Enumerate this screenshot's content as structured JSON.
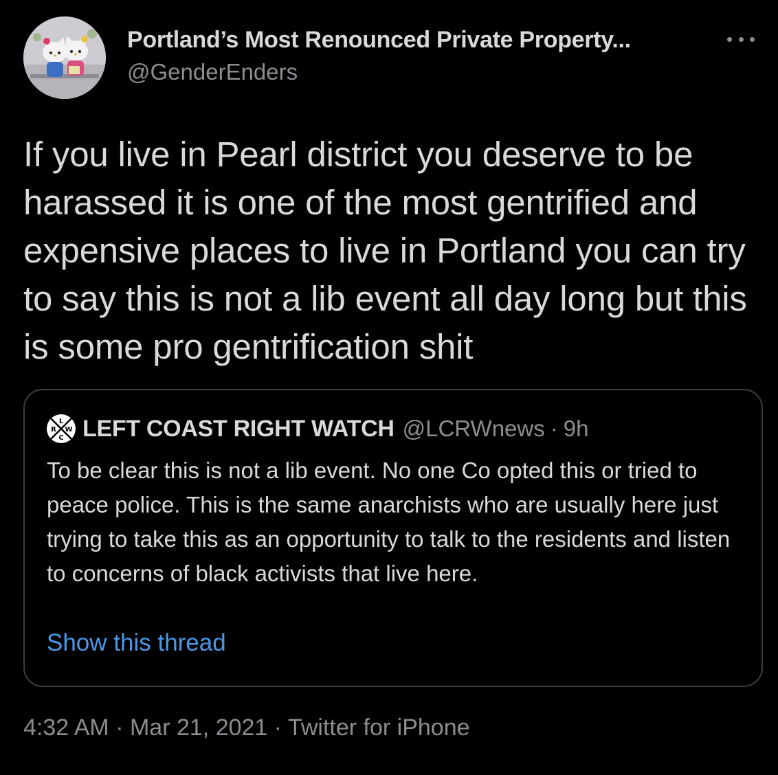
{
  "tweet": {
    "author": {
      "display_name": "Portland’s Most Renounced Private Property...",
      "handle": "@GenderEnders",
      "avatar_icon": "hello-kitty-avatar"
    },
    "text": "If you live in Pearl district you deserve to be harassed it is one of the most gentrified and expensive places to live in Portland you can try to say this is not a lib event all day long but this is some pro gentrification shit",
    "more_icon": "more-options-icon",
    "quoted": {
      "avatar_icon": "lcrw-logo-avatar",
      "avatar_letters": {
        "top": "L",
        "left": "R",
        "right": "W",
        "bottom": "C"
      },
      "display_name": "LEFT COAST RIGHT WATCH",
      "handle": "@LCRWnews",
      "separator": "·",
      "time": "9h",
      "text": "To be clear this is not a lib event. No one Co opted this or tried to peace police. This is the same anarchists who are usually here just trying to take this as an opportunity to talk to the residents and listen to concerns of black activists that live here.",
      "show_thread_label": "Show this thread"
    },
    "meta": {
      "time": "4:32 AM",
      "separator": "·",
      "date": "Mar 21, 2021",
      "source": "Twitter for iPhone"
    }
  },
  "colors": {
    "background": "#000000",
    "primary_text": "#d9d9d9",
    "secondary_text": "#8b8f93",
    "link": "#4a99e9",
    "border": "#3b3f43"
  }
}
